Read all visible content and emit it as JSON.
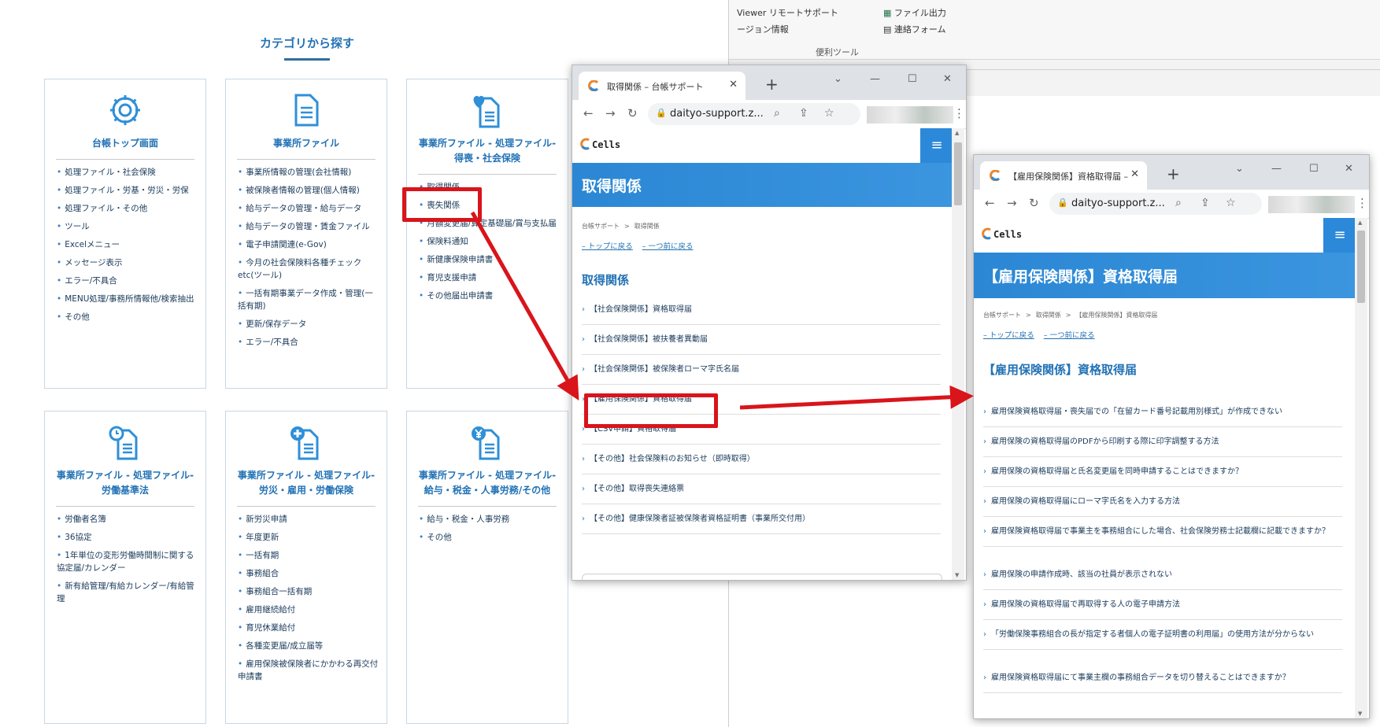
{
  "background_app": {
    "items": [
      "Viewer リモートサポート",
      "ージョン情報",
      "ファイル出力",
      "連絡フォーム"
    ],
    "group_label": "便利ツール"
  },
  "category_page": {
    "title": "カテゴリから探す",
    "cards": [
      {
        "icon": "gear-icon",
        "title": "台帳トップ画面",
        "items": [
          "処理ファイル・社会保険",
          "処理ファイル・労基・労災・労保",
          "処理ファイル・その他",
          "ツール",
          "Excelメニュー",
          "メッセージ表示",
          "エラー/不具合",
          "MENU処理/事務所情報他/検索抽出",
          "その他"
        ]
      },
      {
        "icon": "document-icon",
        "title": "事業所ファイル",
        "items": [
          "事業所情報の管理(会社情報)",
          "被保険者情報の管理(個人情報)",
          "給与データの管理・給与データ",
          "給与データの管理・賃金ファイル",
          "電子申請関連(e-Gov)",
          "今月の社会保険料各種チェックetc(ツール)",
          "一括有期事業データ作成・管理(一括有期)",
          "更新/保存データ",
          "エラー/不具合"
        ]
      },
      {
        "icon": "heart-document-icon",
        "title": "事業所ファイル - 処理ファイル-得喪・社会保険",
        "items": [
          "取得関係",
          "喪失関係",
          "月額変更届/算定基礎届/賞与支払届",
          "保険料通知",
          "新健康保険申請書",
          "育児支援申請",
          "その他届出申請書"
        ]
      },
      {
        "icon": "clock-document-icon",
        "title": "事業所ファイル - 処理ファイル-労働基準法",
        "items": [
          "労働者名簿",
          "36協定",
          "1年単位の変形労働時間制に関する協定届/カレンダー",
          "新有給管理/有給カレンダー/有給管理"
        ]
      },
      {
        "icon": "plus-document-icon",
        "title": "事業所ファイル - 処理ファイル-労災・雇用・労働保険",
        "items": [
          "新労災申請",
          "年度更新",
          "一括有期",
          "事務組合",
          "事務組合一括有期",
          "雇用継続給付",
          "育児休業給付",
          "各種変更届/成立届等",
          "雇用保険被保険者にかかわる再交付申請書"
        ]
      },
      {
        "icon": "yen-document-icon",
        "title": "事業所ファイル - 処理ファイル-給与・税金・人事労務/その他",
        "items": [
          "給与・税金・人事労務",
          "その他"
        ]
      }
    ]
  },
  "browser1": {
    "tab_title": "取得関係 – 台帳サポート",
    "url": "daityo-support.z...",
    "logo_text": "Cells",
    "hero_title": "取得関係",
    "breadcrumb": [
      "台帳サポート",
      ">",
      "取得関係"
    ],
    "back_top": "– トップに戻る",
    "back_one": "– 一つ前に戻る",
    "section_title": "取得関係",
    "links": [
      "【社会保険関係】資格取得届",
      "【社会保険関係】被扶養者異動届",
      "【社会保険関係】被保険者ローマ字氏名届",
      "【雇用保険関係】資格取得届",
      "【CSV申請】資格取得届",
      "【その他】社会保険料のお知らせ（即時取得）",
      "【その他】取得喪失連絡票",
      "【その他】健康保険者証被保険者資格証明書（事業所交付用）"
    ]
  },
  "browser2": {
    "tab_title": "【雇用保険関係】資格取得届 –",
    "url": "daityo-support.z...",
    "logo_text": "Cells",
    "hero_title": "【雇用保険関係】資格取得届",
    "breadcrumb": [
      "台帳サポート",
      ">",
      "取得関係",
      ">",
      "【雇用保険関係】資格取得届"
    ],
    "back_top": "– トップに戻る",
    "back_one": "– 一つ前に戻る",
    "section_title": "【雇用保険関係】資格取得届",
    "links": [
      "雇用保険資格取得届・喪失届での「在留カード番号記載用別様式」が作成できない",
      "雇用保険の資格取得届のPDFから印刷する際に印字調整する方法",
      "雇用保険の資格取得届と氏名変更届を同時申請することはできますか？",
      "雇用保険の資格取得届にローマ字氏名を入力する方法",
      "雇用保険資格取得届で事業主を事務組合にした場合、社会保険労務士記載欄に記載できますか？",
      "雇用保険の申請作成時、該当の社員が表示されない",
      "雇用保険の資格取得届で再取得する人の電子申請方法",
      "「労働保険事務組合の長が指定する者個人の電子証明書の利用届」の使用方法が分からない",
      "雇用保険資格取得届にて事業主欄の事務組合データを切り替えることはできますか？"
    ]
  },
  "colors": {
    "accent": "#2d8ad6",
    "highlight": "#d9141b",
    "heading": "#2272b5"
  }
}
